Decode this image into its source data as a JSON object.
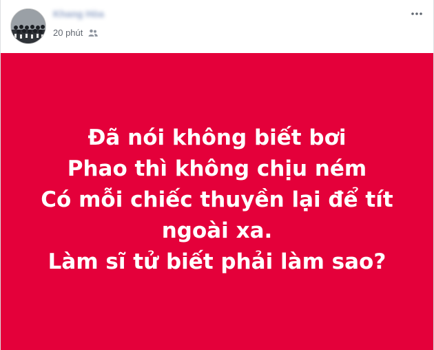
{
  "post": {
    "author_name": "Khang Hòa",
    "time": "20 phút",
    "audience_icon": "friends-icon",
    "more_icon": "more-options-icon",
    "background_color": "#e4003a",
    "text_lines": [
      "Đã nói không biết bơi",
      "Phao thì không chịu ném",
      "Có mỗi chiếc thuyền lại để tít",
      "ngoài xa.",
      "Làm sĩ tử biết phải làm sao?"
    ]
  }
}
